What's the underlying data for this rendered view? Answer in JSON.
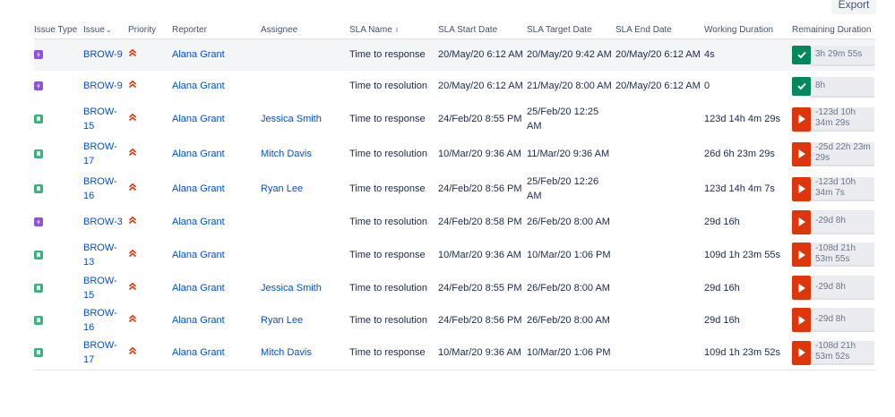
{
  "toolbar": {
    "export_label": "Export"
  },
  "columns": {
    "issue_type": "Issue Type",
    "issue": "Issue",
    "issue_sort": "⌄",
    "priority": "Priority",
    "reporter": "Reporter",
    "assignee": "Assignee",
    "sla_name": "SLA Name",
    "sla_name_sort": "⇕",
    "sla_start": "SLA Start Date",
    "sla_target": "SLA Target Date",
    "sla_end": "SLA End Date",
    "working": "Working Duration",
    "remaining": "Remaining Duration"
  },
  "colors": {
    "link": "#0052cc",
    "type_change": "#904ee2",
    "type_story": "#36b37e",
    "priority_high": "#de350b",
    "sla_met": "#00875a",
    "sla_breached": "#de350b"
  },
  "rows": [
    {
      "type_icon": "lightning-icon",
      "issue": "BROW-9",
      "priority_icon": "priority-highest-icon",
      "reporter": "Alana Grant",
      "assignee": "",
      "sla_name": "Time to response",
      "start": "20/May/20 6:12 AM",
      "target": "20/May/20 9:42 AM",
      "end": "20/May/20 6:12 AM",
      "working": "4s",
      "remaining": "3h 29m 55s",
      "status": "met"
    },
    {
      "type_icon": "lightning-icon",
      "issue": "BROW-9",
      "priority_icon": "priority-highest-icon",
      "reporter": "Alana Grant",
      "assignee": "",
      "sla_name": "Time to resolution",
      "start": "20/May/20 6:12 AM",
      "target": "21/May/20 8:00 AM",
      "end": "20/May/20 6:12 AM",
      "working": "0",
      "remaining": "8h",
      "status": "met"
    },
    {
      "type_icon": "bookmark-icon",
      "issue": "BROW-15",
      "priority_icon": "priority-highest-icon",
      "reporter": "Alana Grant",
      "assignee": "Jessica Smith",
      "sla_name": "Time to response",
      "start": "24/Feb/20 8:55 PM",
      "target": "25/Feb/20 12:25 AM",
      "end": "",
      "working": "123d 14h 4m 29s",
      "remaining": "-123d 10h 34m 29s",
      "status": "breached"
    },
    {
      "type_icon": "bookmark-icon",
      "issue": "BROW-17",
      "priority_icon": "priority-highest-icon",
      "reporter": "Alana Grant",
      "assignee": "Mitch Davis",
      "sla_name": "Time to resolution",
      "start": "10/Mar/20 9:36 AM",
      "target": "11/Mar/20 9:36 AM",
      "end": "",
      "working": "26d 6h 23m 29s",
      "remaining": "-25d 22h 23m 29s",
      "status": "breached"
    },
    {
      "type_icon": "bookmark-icon",
      "issue": "BROW-16",
      "priority_icon": "priority-highest-icon",
      "reporter": "Alana Grant",
      "assignee": "Ryan Lee",
      "sla_name": "Time to response",
      "start": "24/Feb/20 8:56 PM",
      "target": "25/Feb/20 12:26 AM",
      "end": "",
      "working": "123d 14h 4m 7s",
      "remaining": "-123d 10h 34m 7s",
      "status": "breached"
    },
    {
      "type_icon": "lightning-icon",
      "issue": "BROW-3",
      "priority_icon": "priority-highest-icon",
      "reporter": "Alana Grant",
      "assignee": "",
      "sla_name": "Time to resolution",
      "start": "24/Feb/20 8:58 PM",
      "target": "26/Feb/20 8:00 AM",
      "end": "",
      "working": "29d 16h",
      "remaining": "-29d 8h",
      "status": "breached"
    },
    {
      "type_icon": "bookmark-icon",
      "issue": "BROW-13",
      "priority_icon": "priority-highest-icon",
      "reporter": "Alana Grant",
      "assignee": "",
      "sla_name": "Time to response",
      "start": "10/Mar/20 9:36 AM",
      "target": "10/Mar/20 1:06 PM",
      "end": "",
      "working": "109d 1h 23m 55s",
      "remaining": "-108d 21h 53m 55s",
      "status": "breached"
    },
    {
      "type_icon": "bookmark-icon",
      "issue": "BROW-15",
      "priority_icon": "priority-highest-icon",
      "reporter": "Alana Grant",
      "assignee": "Jessica Smith",
      "sla_name": "Time to resolution",
      "start": "24/Feb/20 8:55 PM",
      "target": "26/Feb/20 8:00 AM",
      "end": "",
      "working": "29d 16h",
      "remaining": "-29d 8h",
      "status": "breached"
    },
    {
      "type_icon": "bookmark-icon",
      "issue": "BROW-16",
      "priority_icon": "priority-highest-icon",
      "reporter": "Alana Grant",
      "assignee": "Ryan Lee",
      "sla_name": "Time to resolution",
      "start": "24/Feb/20 8:56 PM",
      "target": "26/Feb/20 8:00 AM",
      "end": "",
      "working": "29d 16h",
      "remaining": "-29d 8h",
      "status": "breached"
    },
    {
      "type_icon": "bookmark-icon",
      "issue": "BROW-17",
      "priority_icon": "priority-highest-icon",
      "reporter": "Alana Grant",
      "assignee": "Mitch Davis",
      "sla_name": "Time to response",
      "start": "10/Mar/20 9:36 AM",
      "target": "10/Mar/20 1:06 PM",
      "end": "",
      "working": "109d 1h 23m 52s",
      "remaining": "-108d 21h 53m 52s",
      "status": "breached"
    }
  ]
}
